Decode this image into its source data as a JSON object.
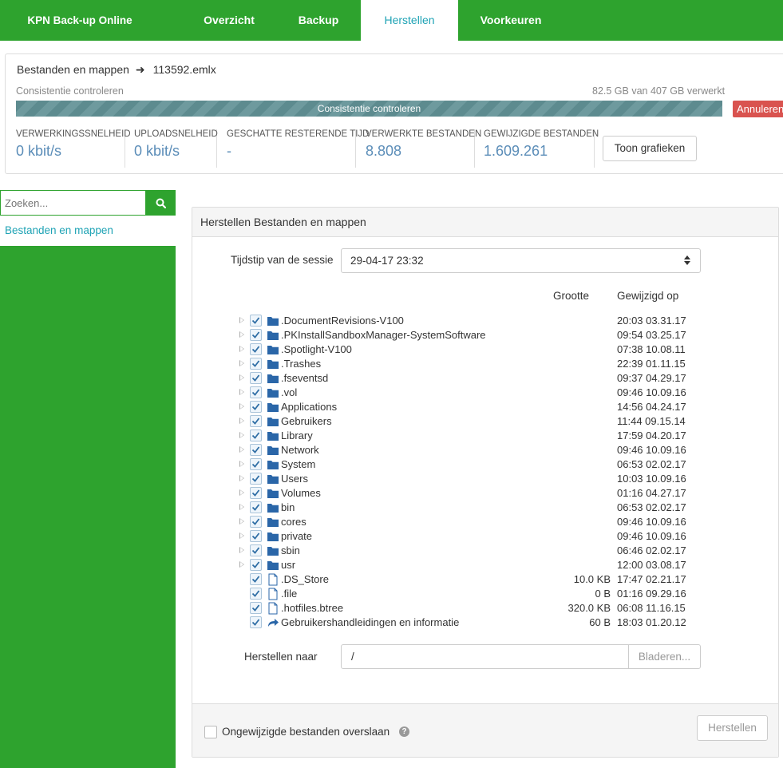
{
  "app": {
    "brand": "KPN Back-up Online"
  },
  "nav": {
    "tabs": [
      "Overzicht",
      "Backup",
      "Herstellen",
      "Voorkeuren"
    ],
    "active": "Herstellen"
  },
  "progress": {
    "crumb_root": "Bestanden en mappen",
    "crumb_file": "113592.emlx",
    "status": "Consistentie controleren",
    "processed": "82.5 GB van 407 GB verwerkt",
    "bar_label": "Consistentie controleren",
    "cancel_label": "Annuleren",
    "stats": [
      {
        "label": "VERWERKINGSSNELHEID",
        "value": "0 kbit/s"
      },
      {
        "label": "UPLOADSNELHEID",
        "value": "0 kbit/s"
      },
      {
        "label": "GESCHATTE RESTERENDE TIJD",
        "value": "-"
      },
      {
        "label": "VERWERKTE BESTANDEN",
        "value": "8.808"
      },
      {
        "label": "GEWIJZIGDE BESTANDEN",
        "value": "1.609.261"
      }
    ],
    "graph_button": "Toon grafieken"
  },
  "sidebar": {
    "search_placeholder": "Zoeken...",
    "items": [
      "Bestanden en mappen"
    ]
  },
  "restore": {
    "title": "Herstellen Bestanden en mappen",
    "session_label": "Tijdstip van de sessie",
    "session_value": "29-04-17 23:32",
    "col_size": "Grootte",
    "col_modified": "Gewijzigd op",
    "items": [
      {
        "name": ".DocumentRevisions-V100",
        "type": "folder",
        "size": "",
        "modified": "20:03 03.31.17"
      },
      {
        "name": ".PKInstallSandboxManager-SystemSoftware",
        "type": "folder",
        "size": "",
        "modified": "09:54 03.25.17"
      },
      {
        "name": ".Spotlight-V100",
        "type": "folder",
        "size": "",
        "modified": "07:38 10.08.11"
      },
      {
        "name": ".Trashes",
        "type": "folder",
        "size": "",
        "modified": "22:39 01.11.15"
      },
      {
        "name": ".fseventsd",
        "type": "folder",
        "size": "",
        "modified": "09:37 04.29.17"
      },
      {
        "name": ".vol",
        "type": "folder",
        "size": "",
        "modified": "09:46 10.09.16"
      },
      {
        "name": "Applications",
        "type": "folder",
        "size": "",
        "modified": "14:56 04.24.17"
      },
      {
        "name": "Gebruikers",
        "type": "folder",
        "size": "",
        "modified": "11:44 09.15.14"
      },
      {
        "name": "Library",
        "type": "folder",
        "size": "",
        "modified": "17:59 04.20.17"
      },
      {
        "name": "Network",
        "type": "folder",
        "size": "",
        "modified": "09:46 10.09.16"
      },
      {
        "name": "System",
        "type": "folder",
        "size": "",
        "modified": "06:53 02.02.17"
      },
      {
        "name": "Users",
        "type": "folder",
        "size": "",
        "modified": "10:03 10.09.16"
      },
      {
        "name": "Volumes",
        "type": "folder",
        "size": "",
        "modified": "01:16 04.27.17"
      },
      {
        "name": "bin",
        "type": "folder",
        "size": "",
        "modified": "06:53 02.02.17"
      },
      {
        "name": "cores",
        "type": "folder",
        "size": "",
        "modified": "09:46 10.09.16"
      },
      {
        "name": "private",
        "type": "folder",
        "size": "",
        "modified": "09:46 10.09.16"
      },
      {
        "name": "sbin",
        "type": "folder",
        "size": "",
        "modified": "06:46 02.02.17"
      },
      {
        "name": "usr",
        "type": "folder",
        "size": "",
        "modified": "12:00 03.08.17"
      },
      {
        "name": ".DS_Store",
        "type": "file",
        "size": "10.0 KB",
        "modified": "17:47 02.21.17"
      },
      {
        "name": ".file",
        "type": "file",
        "size": "0 B",
        "modified": "01:16 09.29.16"
      },
      {
        "name": ".hotfiles.btree",
        "type": "file",
        "size": "320.0 KB",
        "modified": "06:08 11.16.15"
      },
      {
        "name": "Gebruikershandleidingen en informatie",
        "type": "link",
        "size": "60 B",
        "modified": "18:03 01.20.12"
      }
    ],
    "dest_label": "Herstellen naar",
    "dest_value": "/",
    "browse_label": "Bladeren...",
    "skip_label": "Ongewijzigde bestanden overslaan",
    "restore_button": "Herstellen"
  },
  "colors": {
    "brand_green": "#2ea32e",
    "accent_teal": "#1fa3b5",
    "danger": "#d9534f",
    "stat_blue": "#5b8db8"
  }
}
